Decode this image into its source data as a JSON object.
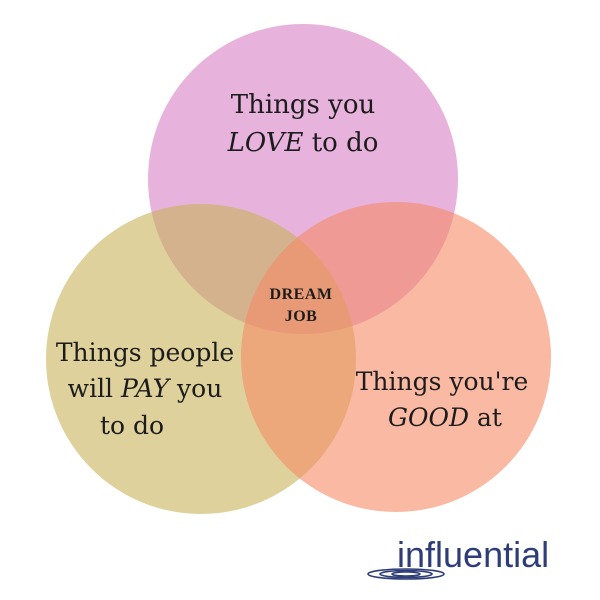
{
  "colors": {
    "love": "#d77fc3",
    "pay": "#c8b25a",
    "good": "#f58a65",
    "text": "#1c1c1c",
    "brand": "#2e3d78"
  },
  "circles": {
    "love": {
      "line1": "Things you",
      "emphasis": "LOVE",
      "rest": "to do"
    },
    "pay": {
      "line1": "Things people",
      "line2_pre": "will",
      "emphasis": "PAY",
      "line2_post": "you",
      "line3": "to do"
    },
    "good": {
      "line1": "Things you're",
      "emphasis": "GOOD",
      "rest": "at"
    }
  },
  "center": {
    "line1": "DREAM",
    "line2": "JOB"
  },
  "brand": {
    "name": "influential",
    "icon": "ripple-logo-icon"
  }
}
